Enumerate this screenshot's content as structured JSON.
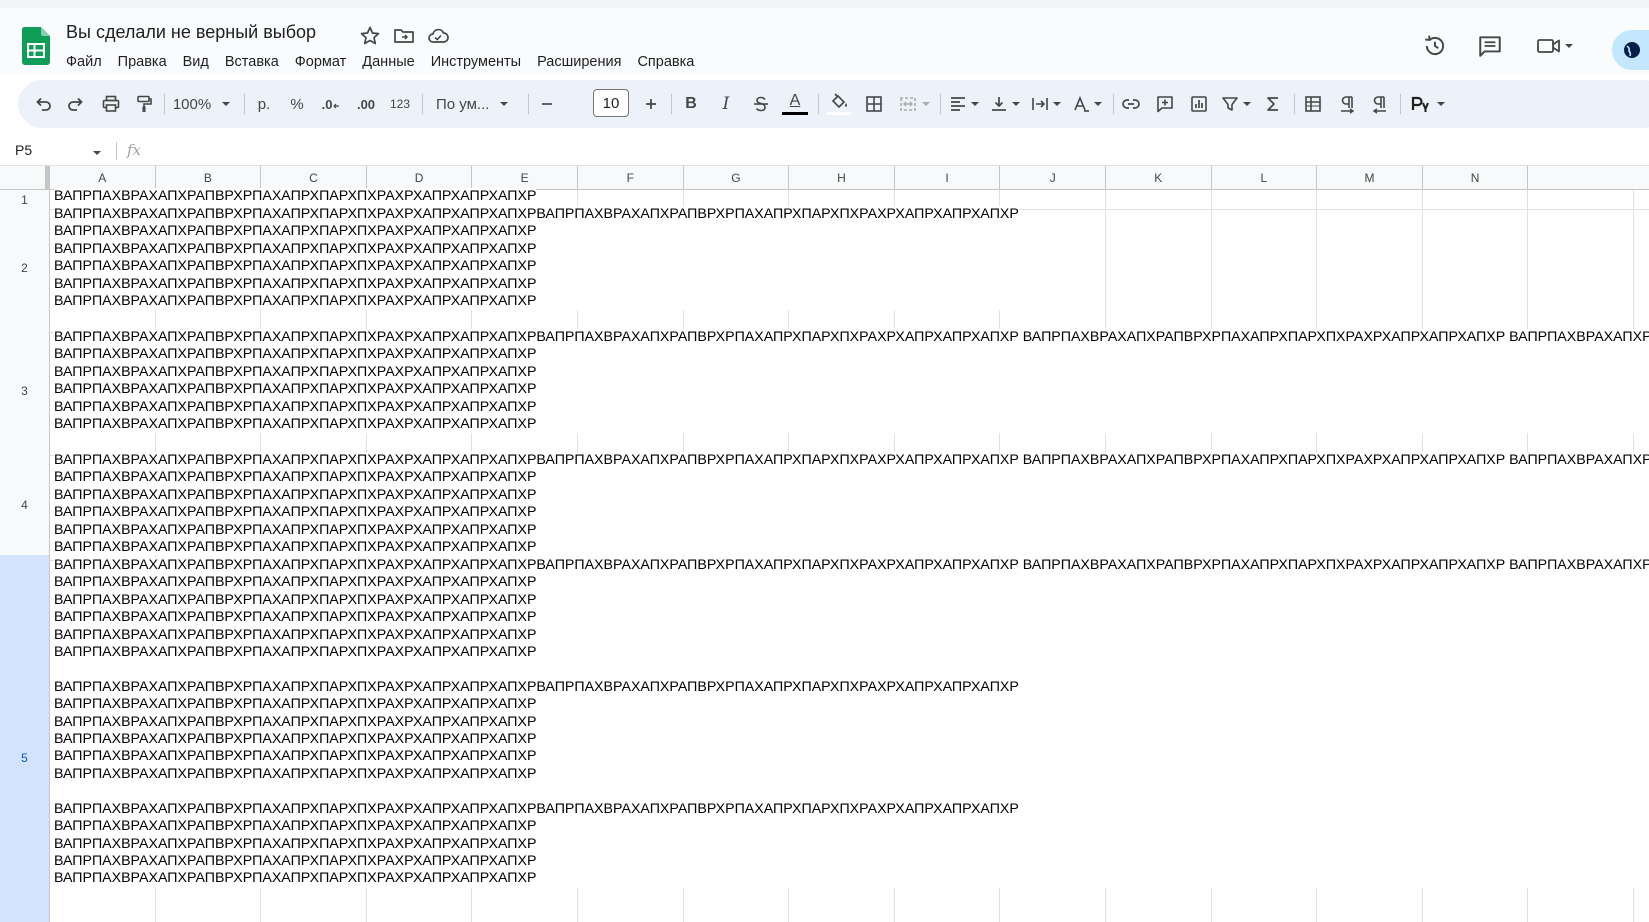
{
  "document": {
    "title": "Вы сделали не верный выбор"
  },
  "menu": [
    "Файл",
    "Правка",
    "Вид",
    "Вставка",
    "Формат",
    "Данные",
    "Инструменты",
    "Расширения",
    "Справка"
  ],
  "toolbar": {
    "zoom": "100%",
    "currency": "р.",
    "percent": "%",
    "decrease_decimal": ".0",
    "increase_decimal": ".00",
    "number_format": "123",
    "font_name": "По ум...",
    "font_size": "10",
    "bold": "B",
    "italic": "I",
    "text_color_letter": "A",
    "accent_color": "#000000"
  },
  "formula_bar": {
    "cell_ref": "P5",
    "fx": "fx",
    "content": ""
  },
  "columns": [
    "A",
    "B",
    "C",
    "D",
    "E",
    "F",
    "G",
    "H",
    "I",
    "J",
    "K",
    "L",
    "M",
    "N"
  ],
  "rows": [
    {
      "label": "1",
      "text": "ВАПРПАХВРАХАПХРАПВРХРПАХАПРХПАРХПХРАХРХАПРХАПРХАПХР"
    },
    {
      "label": "2",
      "text": "ВАПРПАХВРАХАПХРАПВРХРПАХАПРХПАРХПХРАХРХАПРХАПРХАПХРВАПРПАХВРАХАПХРАПВРХРПАХАПРХПАРХПХРАХРХАПРХАПРХАПХР\nВАПРПАХВРАХАПХРАПВРХРПАХАПРХПАРХПХРАХРХАПРХАПРХАПХР\nВАПРПАХВРАХАПХРАПВРХРПАХАПРХПАРХПХРАХРХАПРХАПРХАПХР\nВАПРПАХВРАХАПХРАПВРХРПАХАПРХПАРХПХРАХРХАПРХАПРХАПХР\nВАПРПАХВРАХАПХРАПВРХРПАХАПРХПАРХПХРАХРХАПРХАПРХАПХР\nВАПРПАХВРАХАПХРАПВРХРПАХАПРХПАРХПХРАХРХАПРХАПРХАПХР"
    },
    {
      "label": "3",
      "text": "ВАПРПАХВРАХАПХРАПВРХРПАХАПРХПАРХПХРАХРХАПРХАПРХАПХРВАПРПАХВРАХАПХРАПВРХРПАХАПРХПАРХПХРАХРХАПРХАПРХАПХР ВАПРПАХВРАХАПХРАПВРХРПАХАПРХПАРХПХРАХРХАПРХАПРХАПХР ВАПРПАХВРАХАПХРАПВРХРПАХАПРХПАРХПХРАХРХАПРХАПРХАПХР\nВАПРПАХВРАХАПХРАПВРХРПАХАПРХПАРХПХРАХРХАПРХАПРХАПХР\nВАПРПАХВРАХАПХРАПВРХРПАХАПРХПАРХПХРАХРХАПРХАПРХАПХР\nВАПРПАХВРАХАПХРАПВРХРПАХАПРХПАРХПХРАХРХАПРХАПРХАПХР\nВАПРПАХВРАХАПХРАПВРХРПАХАПРХПАРХПХРАХРХАПРХАПРХАПХР\nВАПРПАХВРАХАПХРАПВРХРПАХАПРХПАРХПХРАХРХАПРХАПРХАПХР"
    },
    {
      "label": "4",
      "text": "ВАПРПАХВРАХАПХРАПВРХРПАХАПРХПАРХПХРАХРХАПРХАПРХАПХРВАПРПАХВРАХАПХРАПВРХРПАХАПРХПАРХПХРАХРХАПРХАПРХАПХР ВАПРПАХВРАХАПХРАПВРХРПАХАПРХПАРХПХРАХРХАПРХАПРХАПХР ВАПРПАХВРАХАПХРАПВРХРПАХАПРХПАРХПХРАХРХАПРХАПРХАПХР\nВАПРПАХВРАХАПХРАПВРХРПАХАПРХПАРХПХРАХРХАПРХАПРХАПХР\nВАПРПАХВРАХАПХРАПВРХРПАХАПРХПАРХПХРАХРХАПРХАПРХАПХР\nВАПРПАХВРАХАПХРАПВРХРПАХАПРХПАРХПХРАХРХАПРХАПРХАПХР\nВАПРПАХВРАХАПХРАПВРХРПАХАПРХПАРХПХРАХРХАПРХАПРХАПХР\nВАПРПАХВРАХАПХРАПВРХРПАХАПРХПАРХПХРАХРХАПРХАПРХАПХР"
    },
    {
      "label": "5",
      "text": "ВАПРПАХВРАХАПХРАПВРХРПАХАПРХПАРХПХРАХРХАПРХАПРХАПХРВАПРПАХВРАХАПХРАПВРХРПАХАПРХПАРХПХРАХРХАПРХАПРХАПХР ВАПРПАХВРАХАПХРАПВРХРПАХАПРХПАРХПХРАХРХАПРХАПРХАПХР ВАПРПАХВРАХАПХРАПВРХРПАХАПРХПАРХПХРАХРХАПРХАПРХАПХР\nВАПРПАХВРАХАПХРАПВРХРПАХАПРХПАРХПХРАХРХАПРХАПРХАПХР\nВАПРПАХВРАХАПХРАПВРХРПАХАПРХПАРХПХРАХРХАПРХАПРХАПХР\nВАПРПАХВРАХАПХРАПВРХРПАХАПРХПАРХПХРАХРХАПРХАПРХАПХР\nВАПРПАХВРАХАПХРАПВРХРПАХАПРХПАРХПХРАХРХАПРХАПРХАПХР\nВАПРПАХВРАХАПХРАПВРХРПАХАПРХПАРХПХРАХРХАПРХАПРХАПХР\n\nВАПРПАХВРАХАПХРАПВРХРПАХАПРХПАРХПХРАХРХАПРХАПРХАПХРВАПРПАХВРАХАПХРАПВРХРПАХАПРХПАРХПХРАХРХАПРХАПРХАПХР\nВАПРПАХВРАХАПХРАПВРХРПАХАПРХПАРХПХРАХРХАПРХАПРХАПХР\nВАПРПАХВРАХАПХРАПВРХРПАХАПРХПАРХПХРАХРХАПРХАПРХАПХР\nВАПРПАХВРАХАПХРАПВРХРПАХАПРХПАРХПХРАХРХАПРХАПРХАПХР\nВАПРПАХВРАХАПХРАПВРХРПАХАПРХПАРХПХРАХРХАПРХАПРХАПХР\nВАПРПАХВРАХАПХРАПВРХРПАХАПРХПАРХПХРАХРХАПРХАПРХАПХР\n\nВАПРПАХВРАХАПХРАПВРХРПАХАПРХПАРХПХРАХРХАПРХАПРХАПХРВАПРПАХВРАХАПХРАПВРХРПАХАПРХПАРХПХРАХРХАПРХАПРХАПХР\nВАПРПАХВРАХАПХРАПВРХРПАХАПРХПАРХПХРАХРХАПРХАПРХАПХР\nВАПРПАХВРАХАПХРАПВРХРПАХАПРХПАРХПХРАХРХАПРХАПРХАПХР\nВАПРПАХВРАХАПХРАПВРХРПАХАПРХПАРХПХРАХРХАПРХАПРХАПХР\nВАПРПАХВРАХАПХРАПВРХРПАХАПРХПАРХПХРАХРХАПРХАПРХАПХР"
    }
  ],
  "colors": {
    "header_bg": "#f9fbfd",
    "toolbar_bg": "#edf2fa",
    "selected_row_bg": "#d3e3fd",
    "sheets_green": "#0f9d58"
  }
}
